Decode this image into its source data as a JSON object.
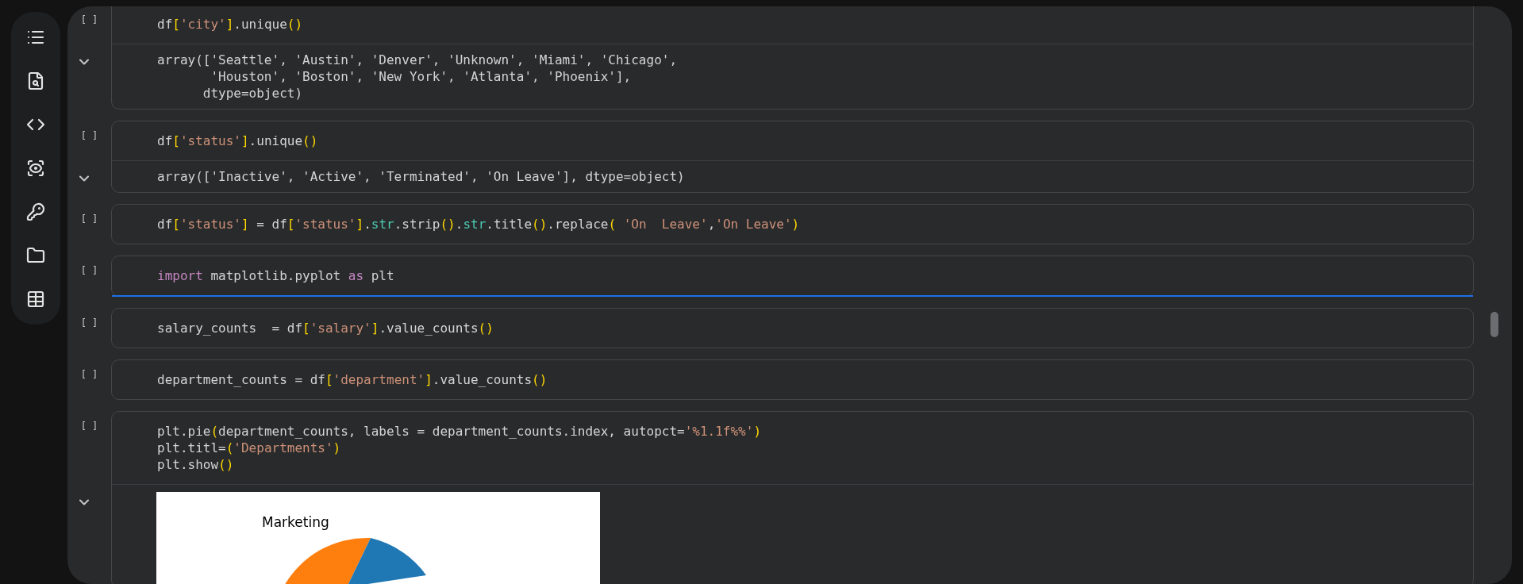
{
  "cells": [
    {
      "marker": "[ ]",
      "selected": false,
      "code": [
        [
          {
            "text": "df",
            "kind": "plain"
          },
          {
            "text": "[",
            "kind": "bracket"
          },
          {
            "text": "'city'",
            "kind": "string"
          },
          {
            "text": "]",
            "kind": "bracket"
          },
          {
            "text": ".unique",
            "kind": "plain"
          },
          {
            "text": "()",
            "kind": "bracket"
          }
        ]
      ],
      "output": {
        "kind": "text",
        "lines": [
          "array(['Seattle', 'Austin', 'Denver', 'Unknown', 'Miami', 'Chicago',",
          "       'Houston', 'Boston', 'New York', 'Atlanta', 'Phoenix'],",
          "      dtype=object)"
        ]
      }
    },
    {
      "marker": "[ ]",
      "selected": false,
      "code": [
        [
          {
            "text": "df",
            "kind": "plain"
          },
          {
            "text": "[",
            "kind": "bracket"
          },
          {
            "text": "'status'",
            "kind": "string"
          },
          {
            "text": "]",
            "kind": "bracket"
          },
          {
            "text": ".unique",
            "kind": "plain"
          },
          {
            "text": "()",
            "kind": "bracket"
          }
        ]
      ],
      "output": {
        "kind": "text",
        "lines": [
          "array(['Inactive', 'Active', 'Terminated', 'On Leave'], dtype=object)"
        ]
      }
    },
    {
      "marker": "[ ]",
      "selected": false,
      "code": [
        [
          {
            "text": "df",
            "kind": "plain"
          },
          {
            "text": "[",
            "kind": "bracket"
          },
          {
            "text": "'status'",
            "kind": "string"
          },
          {
            "text": "]",
            "kind": "bracket"
          },
          {
            "text": " = df",
            "kind": "plain"
          },
          {
            "text": "[",
            "kind": "bracket"
          },
          {
            "text": "'status'",
            "kind": "string"
          },
          {
            "text": "]",
            "kind": "bracket"
          },
          {
            "text": ".",
            "kind": "plain"
          },
          {
            "text": "str",
            "kind": "builtin"
          },
          {
            "text": ".strip",
            "kind": "plain"
          },
          {
            "text": "()",
            "kind": "bracket"
          },
          {
            "text": ".",
            "kind": "plain"
          },
          {
            "text": "str",
            "kind": "builtin"
          },
          {
            "text": ".title",
            "kind": "plain"
          },
          {
            "text": "()",
            "kind": "bracket"
          },
          {
            "text": ".replace",
            "kind": "plain"
          },
          {
            "text": "( ",
            "kind": "bracket"
          },
          {
            "text": "'On  Leave'",
            "kind": "string"
          },
          {
            "text": ",",
            "kind": "plain"
          },
          {
            "text": "'On Leave'",
            "kind": "string"
          },
          {
            "text": ")",
            "kind": "bracket"
          }
        ]
      ]
    },
    {
      "marker": "[ ]",
      "selected": true,
      "code": [
        [
          {
            "text": "import",
            "kind": "keyword"
          },
          {
            "text": " matplotlib.pyplot ",
            "kind": "plain"
          },
          {
            "text": "as",
            "kind": "keyword"
          },
          {
            "text": " plt",
            "kind": "plain"
          }
        ]
      ]
    },
    {
      "marker": "[ ]",
      "selected": false,
      "code": [
        [
          {
            "text": "salary_counts  = df",
            "kind": "plain"
          },
          {
            "text": "[",
            "kind": "bracket"
          },
          {
            "text": "'salary'",
            "kind": "string"
          },
          {
            "text": "]",
            "kind": "bracket"
          },
          {
            "text": ".value_counts",
            "kind": "plain"
          },
          {
            "text": "()",
            "kind": "bracket"
          }
        ]
      ]
    },
    {
      "marker": "[ ]",
      "selected": false,
      "code": [
        [
          {
            "text": "department_counts = df",
            "kind": "plain"
          },
          {
            "text": "[",
            "kind": "bracket"
          },
          {
            "text": "'department'",
            "kind": "string"
          },
          {
            "text": "]",
            "kind": "bracket"
          },
          {
            "text": ".value_counts",
            "kind": "plain"
          },
          {
            "text": "()",
            "kind": "bracket"
          }
        ]
      ]
    },
    {
      "marker": "[ ]",
      "selected": false,
      "code": [
        [
          {
            "text": "plt.pie",
            "kind": "plain"
          },
          {
            "text": "(",
            "kind": "bracket"
          },
          {
            "text": "department_counts, labels = department_counts.index, autopct=",
            "kind": "plain"
          },
          {
            "text": "'%1.1f%%'",
            "kind": "string"
          },
          {
            "text": ")",
            "kind": "bracket"
          }
        ],
        [
          {
            "text": "plt.titl=",
            "kind": "plain"
          },
          {
            "text": "(",
            "kind": "bracket"
          },
          {
            "text": "'Departments'",
            "kind": "string"
          },
          {
            "text": ")",
            "kind": "bracket"
          }
        ],
        [
          {
            "text": "plt.show",
            "kind": "plain"
          },
          {
            "text": "()",
            "kind": "bracket"
          }
        ]
      ],
      "output": {
        "kind": "figure",
        "label": "Marketing"
      }
    }
  ]
}
